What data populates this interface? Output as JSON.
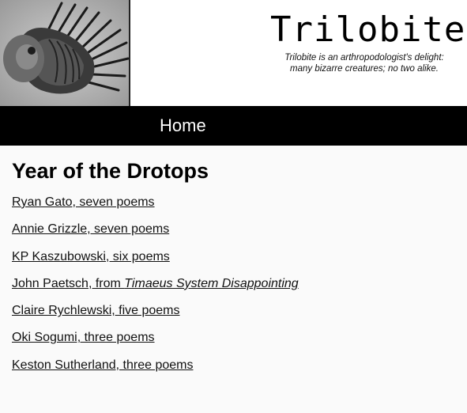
{
  "header": {
    "title": "Trilobite",
    "tagline_line1": "Trilobite is an arthropodologist's delight:",
    "tagline_line2": "many bizarre creatures; no two alike.",
    "logo_icon": "trilobite-fossil-photo"
  },
  "nav": {
    "home_label": "Home"
  },
  "main": {
    "heading": "Year of the Drotops",
    "links": [
      {
        "text": "Ryan Gato, seven poems"
      },
      {
        "text": "Annie Grizzle, seven poems"
      },
      {
        "text": "KP Kaszubowski, six poems"
      },
      {
        "text_prefix": "John Paetsch, from ",
        "text_italic": "Timaeus System Disappointing"
      },
      {
        "text": "Claire Rychlewski, five poems"
      },
      {
        "text": "Oki Sogumi, three poems"
      },
      {
        "text": "Keston Sutherland, three poems"
      }
    ]
  },
  "colors": {
    "nav_background": "#000000",
    "page_background": "#fafafa",
    "link_color": "#111111"
  }
}
